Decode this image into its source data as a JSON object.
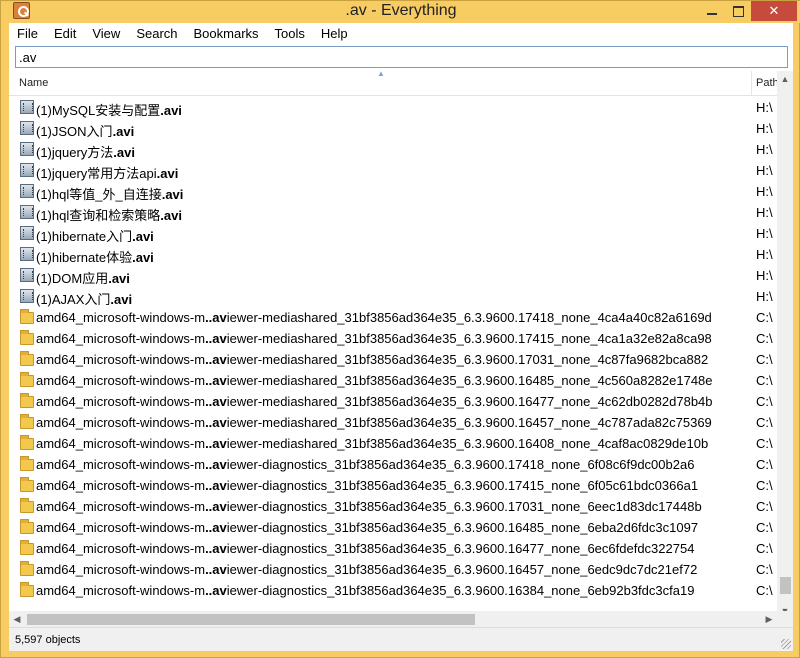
{
  "window": {
    "title": ".av - Everything"
  },
  "menu": [
    "File",
    "Edit",
    "View",
    "Search",
    "Bookmarks",
    "Tools",
    "Help"
  ],
  "search": {
    "value": ".av"
  },
  "columns": {
    "name": "Name",
    "path": "Path"
  },
  "rows": [
    {
      "type": "file",
      "pre": "(1)MySQL安装与配置",
      "match": ".avi",
      "post": "",
      "path": "H:\\"
    },
    {
      "type": "file",
      "pre": "(1)JSON入门",
      "match": ".avi",
      "post": "",
      "path": "H:\\"
    },
    {
      "type": "file",
      "pre": "(1)jquery方法",
      "match": ".avi",
      "post": "",
      "path": "H:\\"
    },
    {
      "type": "file",
      "pre": "(1)jquery常用方法api",
      "match": ".avi",
      "post": "",
      "path": "H:\\"
    },
    {
      "type": "file",
      "pre": "(1)hql等值_外_自连接",
      "match": ".avi",
      "post": "",
      "path": "H:\\"
    },
    {
      "type": "file",
      "pre": "(1)hql查询和检索策略",
      "match": ".avi",
      "post": "",
      "path": "H:\\"
    },
    {
      "type": "file",
      "pre": "(1)hibernate入门",
      "match": ".avi",
      "post": "",
      "path": "H:\\"
    },
    {
      "type": "file",
      "pre": "(1)hibernate体验",
      "match": ".avi",
      "post": "",
      "path": "H:\\"
    },
    {
      "type": "file",
      "pre": "(1)DOM应用",
      "match": ".avi",
      "post": "",
      "path": "H:\\"
    },
    {
      "type": "file",
      "pre": "(1)AJAX入门",
      "match": ".avi",
      "post": "",
      "path": "H:\\"
    },
    {
      "type": "folder",
      "pre": "amd64_microsoft-windows-m",
      "match": "..av",
      "post": "iewer-mediashared_31bf3856ad364e35_6.3.9600.17418_none_4ca4a40c82a6169d",
      "path": "C:\\"
    },
    {
      "type": "folder",
      "pre": "amd64_microsoft-windows-m",
      "match": "..av",
      "post": "iewer-mediashared_31bf3856ad364e35_6.3.9600.17415_none_4ca1a32e82a8ca98",
      "path": "C:\\"
    },
    {
      "type": "folder",
      "pre": "amd64_microsoft-windows-m",
      "match": "..av",
      "post": "iewer-mediashared_31bf3856ad364e35_6.3.9600.17031_none_4c87fa9682bca882",
      "path": "C:\\"
    },
    {
      "type": "folder",
      "pre": "amd64_microsoft-windows-m",
      "match": "..av",
      "post": "iewer-mediashared_31bf3856ad364e35_6.3.9600.16485_none_4c560a8282e1748e",
      "path": "C:\\"
    },
    {
      "type": "folder",
      "pre": "amd64_microsoft-windows-m",
      "match": "..av",
      "post": "iewer-mediashared_31bf3856ad364e35_6.3.9600.16477_none_4c62db0282d78b4b",
      "path": "C:\\"
    },
    {
      "type": "folder",
      "pre": "amd64_microsoft-windows-m",
      "match": "..av",
      "post": "iewer-mediashared_31bf3856ad364e35_6.3.9600.16457_none_4c787ada82c75369",
      "path": "C:\\"
    },
    {
      "type": "folder",
      "pre": "amd64_microsoft-windows-m",
      "match": "..av",
      "post": "iewer-mediashared_31bf3856ad364e35_6.3.9600.16408_none_4caf8ac0829de10b",
      "path": "C:\\"
    },
    {
      "type": "folder",
      "pre": "amd64_microsoft-windows-m",
      "match": "..av",
      "post": "iewer-diagnostics_31bf3856ad364e35_6.3.9600.17418_none_6f08c6f9dc00b2a6",
      "path": "C:\\"
    },
    {
      "type": "folder",
      "pre": "amd64_microsoft-windows-m",
      "match": "..av",
      "post": "iewer-diagnostics_31bf3856ad364e35_6.3.9600.17415_none_6f05c61bdc0366a1",
      "path": "C:\\"
    },
    {
      "type": "folder",
      "pre": "amd64_microsoft-windows-m",
      "match": "..av",
      "post": "iewer-diagnostics_31bf3856ad364e35_6.3.9600.17031_none_6eec1d83dc17448b",
      "path": "C:\\"
    },
    {
      "type": "folder",
      "pre": "amd64_microsoft-windows-m",
      "match": "..av",
      "post": "iewer-diagnostics_31bf3856ad364e35_6.3.9600.16485_none_6eba2d6fdc3c1097",
      "path": "C:\\"
    },
    {
      "type": "folder",
      "pre": "amd64_microsoft-windows-m",
      "match": "..av",
      "post": "iewer-diagnostics_31bf3856ad364e35_6.3.9600.16477_none_6ec6fdefdc322754",
      "path": "C:\\"
    },
    {
      "type": "folder",
      "pre": "amd64_microsoft-windows-m",
      "match": "..av",
      "post": "iewer-diagnostics_31bf3856ad364e35_6.3.9600.16457_none_6edc9dc7dc21ef72",
      "path": "C:\\"
    },
    {
      "type": "folder",
      "pre": "amd64_microsoft-windows-m",
      "match": "..av",
      "post": "iewer-diagnostics_31bf3856ad364e35_6.3.9600.16384_none_6eb92b3fdc3cfa19",
      "path": "C:\\"
    }
  ],
  "status": {
    "text": "5,597 objects"
  },
  "colors": {
    "frame": "#f7cc63",
    "close": "#c74b3c",
    "search_border": "#7a9cc3"
  },
  "icons": {
    "file": "video-file-icon",
    "folder": "folder-icon"
  }
}
